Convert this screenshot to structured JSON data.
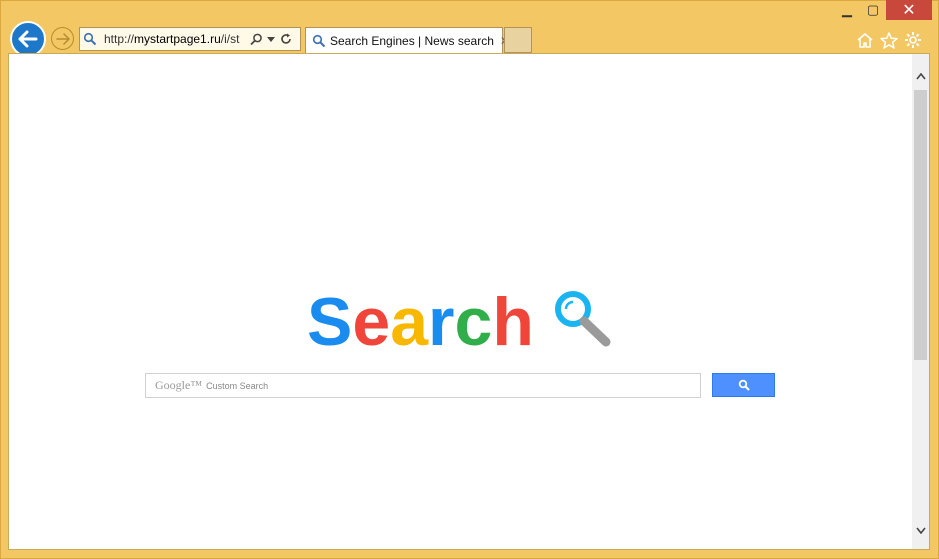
{
  "window": {
    "min_label": "▁",
    "max_label": "▢",
    "close_label": "✕"
  },
  "address_bar": {
    "url_prefix": "http://",
    "url_domain": "mystartpage1.ru",
    "url_rest": "/i/st"
  },
  "tab": {
    "title": "Search Engines | News search",
    "close_label": "✕"
  },
  "logo": {
    "letters": [
      "S",
      "e",
      "a",
      "r",
      "c",
      "h"
    ],
    "colors": [
      "#1a8cf0",
      "#f0453a",
      "#f8b700",
      "#1a8cf0",
      "#2fae4a",
      "#f0453a"
    ]
  },
  "search": {
    "brand": "Google™",
    "placeholder": "Custom Search"
  },
  "colors": {
    "accent": "#1d78c9",
    "frame": "#f3c763",
    "button": "#4d90fe"
  }
}
